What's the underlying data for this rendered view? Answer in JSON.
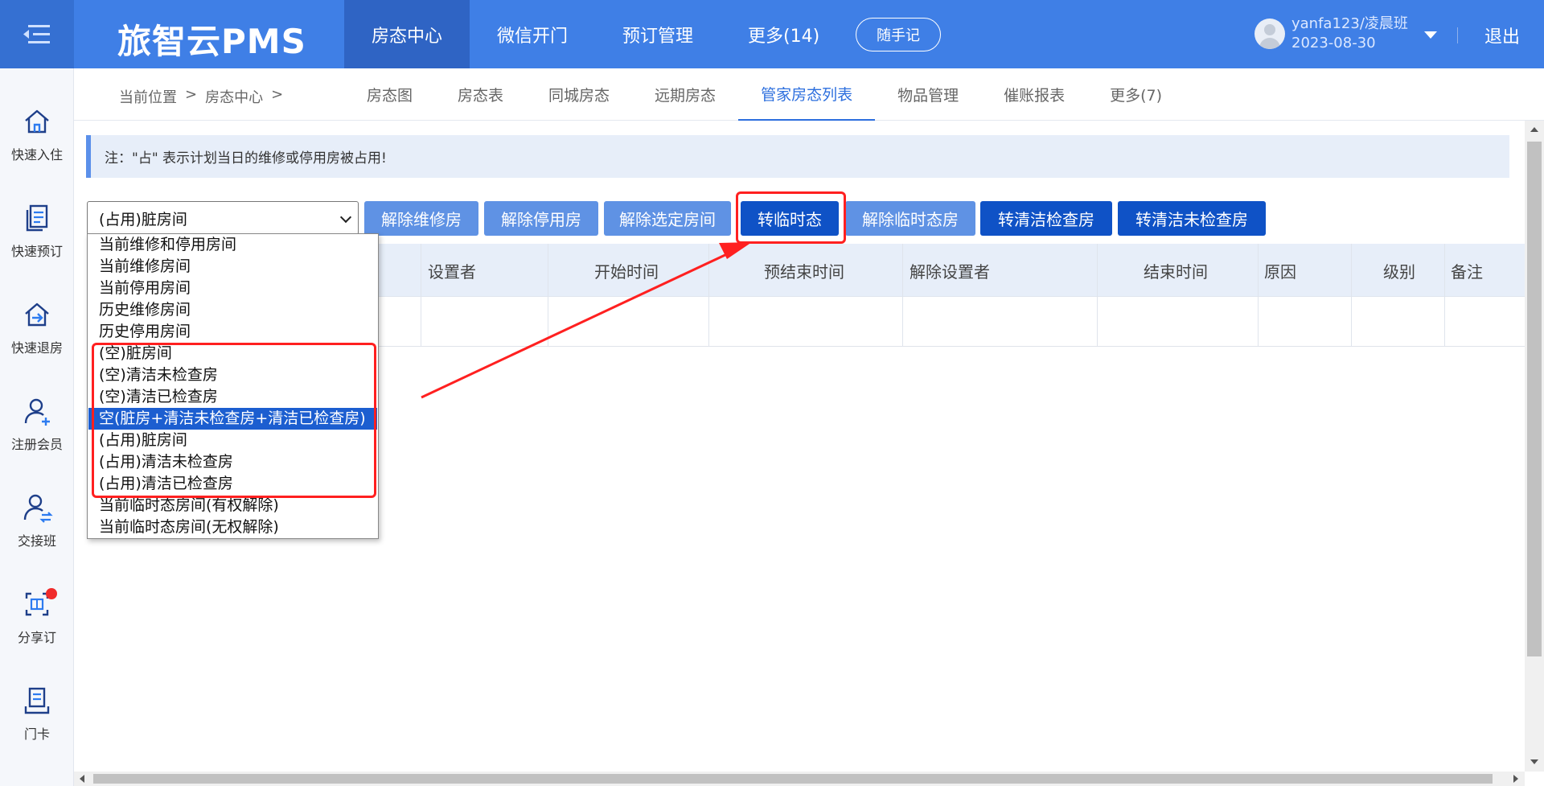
{
  "header": {
    "brand": "旅智云PMS",
    "nav": [
      "房态中心",
      "微信开门",
      "预订管理",
      "更多(14)"
    ],
    "memo_button": "随手记",
    "user": {
      "name": "yanfa123/凌晨班",
      "date": "2023-08-30"
    },
    "logout": "退出"
  },
  "sidebar": {
    "items": [
      {
        "label": "快速入住",
        "icon": "home-icon"
      },
      {
        "label": "快速预订",
        "icon": "booking-icon"
      },
      {
        "label": "快速退房",
        "icon": "checkout-icon"
      },
      {
        "label": "注册会员",
        "icon": "register-member-icon"
      },
      {
        "label": "交接班",
        "icon": "shift-handover-icon"
      },
      {
        "label": "分享订",
        "icon": "share-order-icon"
      },
      {
        "label": "门卡",
        "icon": "door-card-icon"
      }
    ]
  },
  "breadcrumb": {
    "prefix": "当前位置",
    "sep": ">",
    "current": "房态中心"
  },
  "subtabs": [
    "房态图",
    "房态表",
    "同城房态",
    "远期房态",
    "管家房态列表",
    "物品管理",
    "催账报表",
    "更多(7)"
  ],
  "notice": "注：\"占\" 表示计划当日的维修或停用房被占用!",
  "filter": {
    "selected": "(占用)脏房间",
    "options": [
      "当前维修和停用房间",
      "当前维修房间",
      "当前停用房间",
      "历史维修房间",
      "历史停用房间",
      "(空)脏房间",
      "(空)清洁未检查房",
      "(空)清洁已检查房",
      "空(脏房+清洁未检查房+清洁已检查房)",
      "(占用)脏房间",
      "(占用)清洁未检查房",
      "(占用)清洁已检查房",
      "当前临时态房间(有权解除)",
      "当前临时态房间(无权解除)"
    ],
    "highlighted_option": "空(脏房+清洁未检查房+清洁已检查房)"
  },
  "actions": [
    "解除维修房",
    "解除停用房",
    "解除选定房间",
    "转临时态",
    "解除临时态房",
    "转清洁检查房",
    "转清洁未检查房"
  ],
  "table": {
    "columns": [
      "设置者",
      "开始时间",
      "预结束时间",
      "解除设置者",
      "结束时间",
      "原因",
      "级别",
      "备注"
    ]
  },
  "colors": {
    "header": "#3f7fe6",
    "accent": "#2d6fde",
    "dark_button": "#0f52c6",
    "light_button": "#5f92e4",
    "annotation": "#ff2020"
  }
}
